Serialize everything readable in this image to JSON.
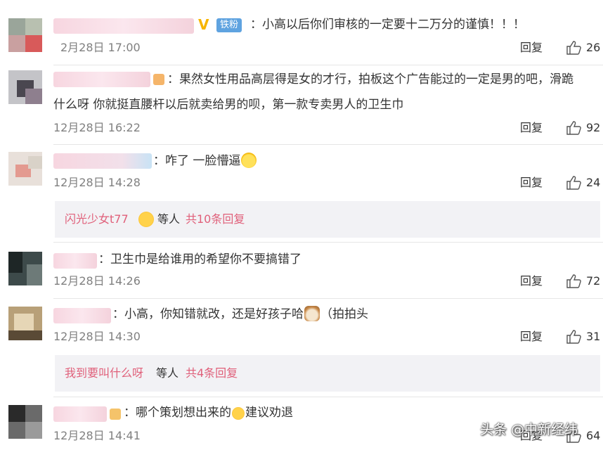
{
  "comments": [
    {
      "badge_fan": "铁粉",
      "text": "：小高以后你们审核的一定要十二万分的谨慎！！！",
      "time": "2月28日 17:00",
      "reply_label": "回复",
      "likes": "26"
    },
    {
      "text_line1": "：果然女性用品高层得是女的才行，拍板这个广告能过的一定是男的吧，滑跪",
      "text_line2": "什么呀 你就挺直腰杆以后就卖给男的呗，第一款专卖男人的卫生巾",
      "time": "12月28日 16:22",
      "reply_label": "回复",
      "likes": "92"
    },
    {
      "text": "：咋了 一脸懵逼",
      "time": "12月28日 14:28",
      "reply_label": "回复",
      "likes": "24",
      "subreply": {
        "who": "闪光少女t77",
        "etc": "等人",
        "more": "共10条回复"
      }
    },
    {
      "text": "：卫生巾是给谁用的希望你不要搞错了",
      "time": "12月28日 14:26",
      "reply_label": "回复",
      "likes": "72"
    },
    {
      "text_before": "：小高，你知错就改，还是好孩子哈",
      "text_after": "（拍拍头",
      "time": "12月28日 14:30",
      "reply_label": "回复",
      "likes": "31",
      "subreply": {
        "who": "我到要叫什么呀",
        "etc": "等人",
        "more": "共4条回复"
      }
    },
    {
      "text_before": "：哪个策划想出来的",
      "text_after": "建议劝退",
      "time": "12月28日 14:41",
      "reply_label": "回复",
      "likes": "64"
    }
  ],
  "watermark": "头条 @中新经纬",
  "colors": {
    "link_pink": "#e0607a",
    "fan_badge_blue": "#5fa3e0",
    "v_badge_gold": "#f7b500",
    "subreply_bg": "#f2f2f5"
  }
}
